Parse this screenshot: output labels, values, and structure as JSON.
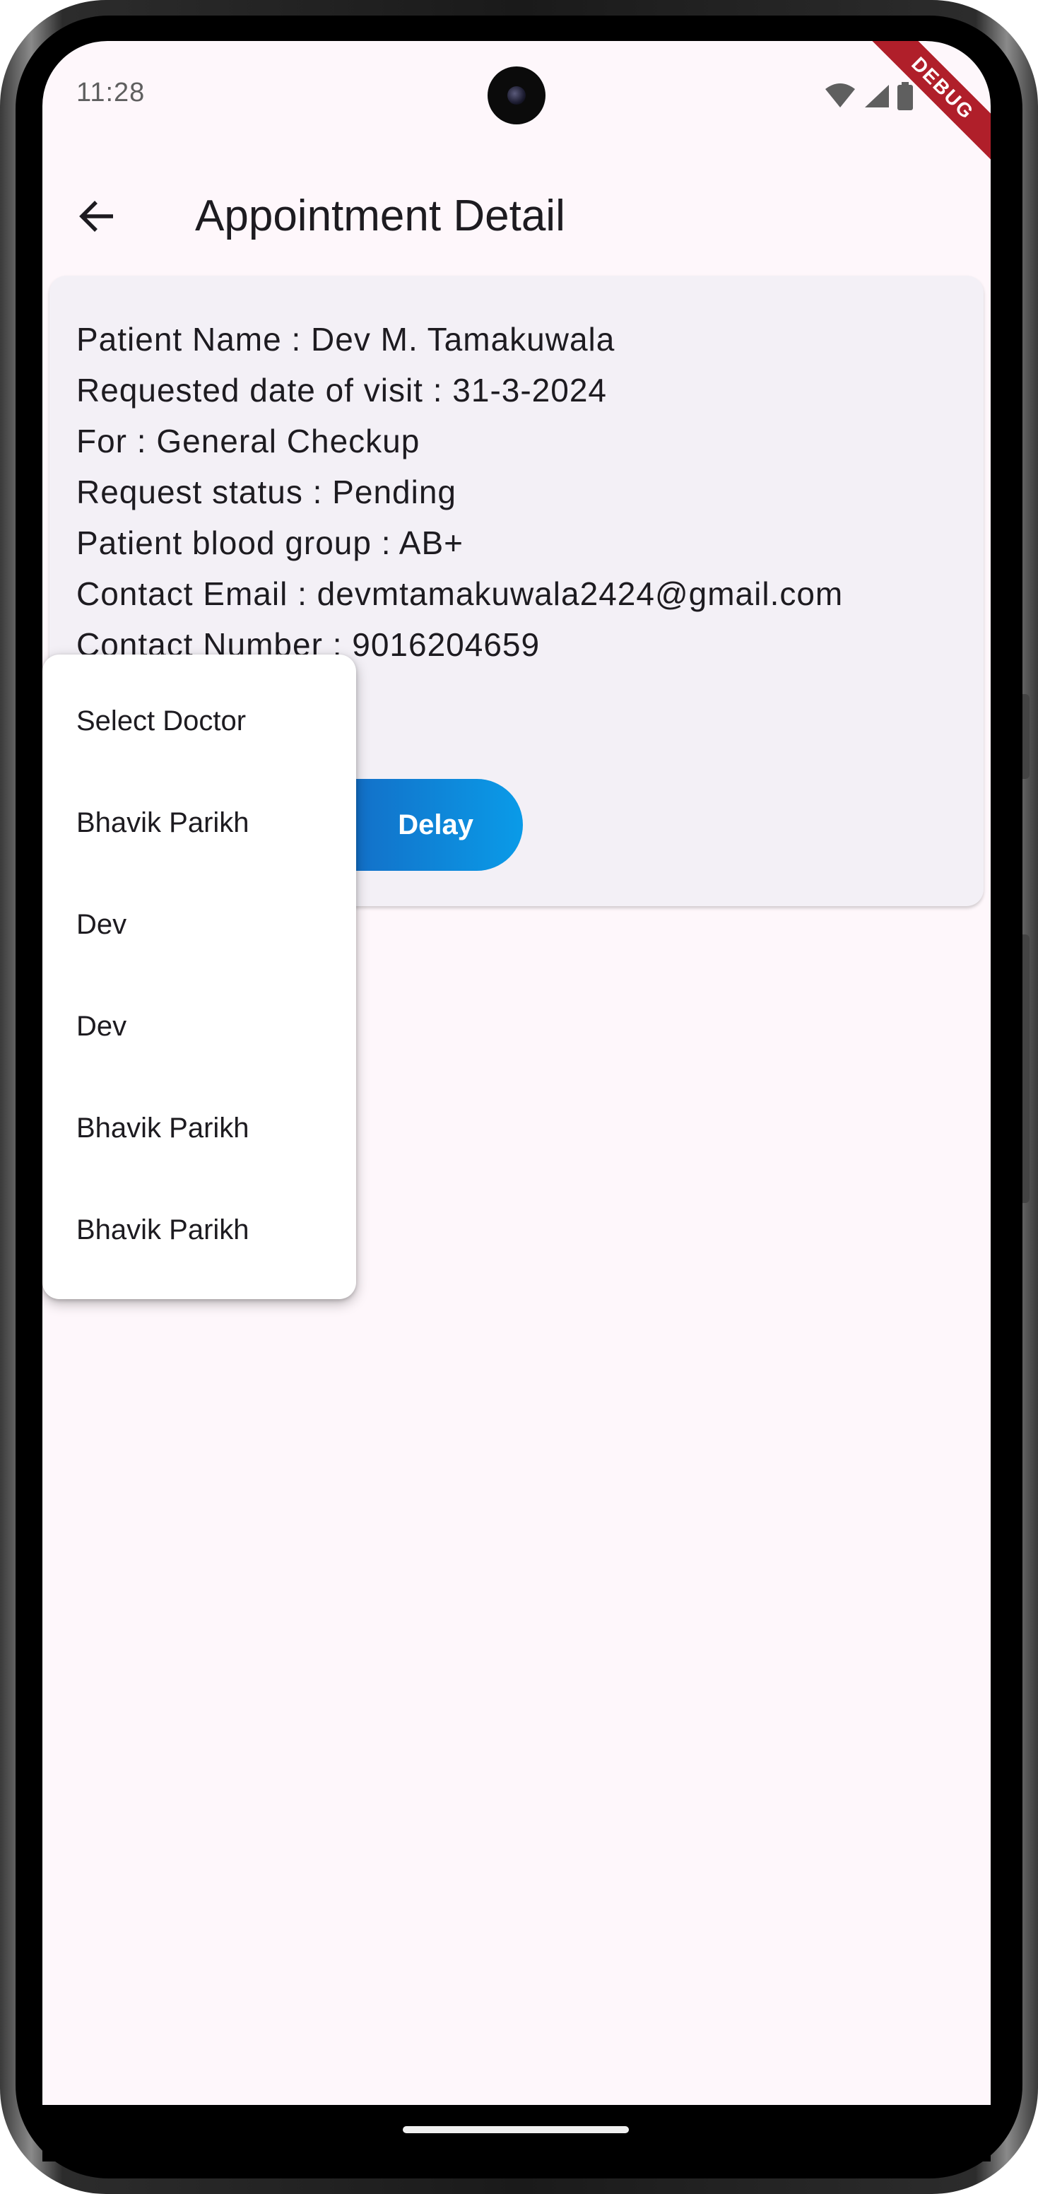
{
  "status_bar": {
    "time": "11:28",
    "icons": [
      "wifi-icon",
      "signal-icon",
      "battery-icon"
    ],
    "debug_label": "DEBUG"
  },
  "app_bar": {
    "title": "Appointment Detail",
    "back_icon": "arrow-left-icon"
  },
  "card": {
    "patient_name": "Patient Name : Dev M. Tamakuwala",
    "visit_date": "Requested date of visit : 31-3-2024",
    "purpose": "For : General Checkup",
    "request_status": "Request status : Pending",
    "blood_group": "Patient blood group : AB+",
    "contact_email": "Contact Email : devmtamakuwala2424@gmail.com",
    "contact_number": "Contact Number : 9016204659",
    "delay_button_label": "Delay"
  },
  "dropdown": {
    "items": [
      "Select Doctor",
      "Bhavik Parikh",
      "Dev",
      "Dev",
      "Bhavik Parikh",
      "Bhavik Parikh"
    ]
  },
  "colors": {
    "background": "#fef7fb",
    "card": "#f3f0f6",
    "button_gradient_start": "#1565c0",
    "button_gradient_end": "#0a9be8",
    "debug_ribbon": "#b01f2a"
  }
}
